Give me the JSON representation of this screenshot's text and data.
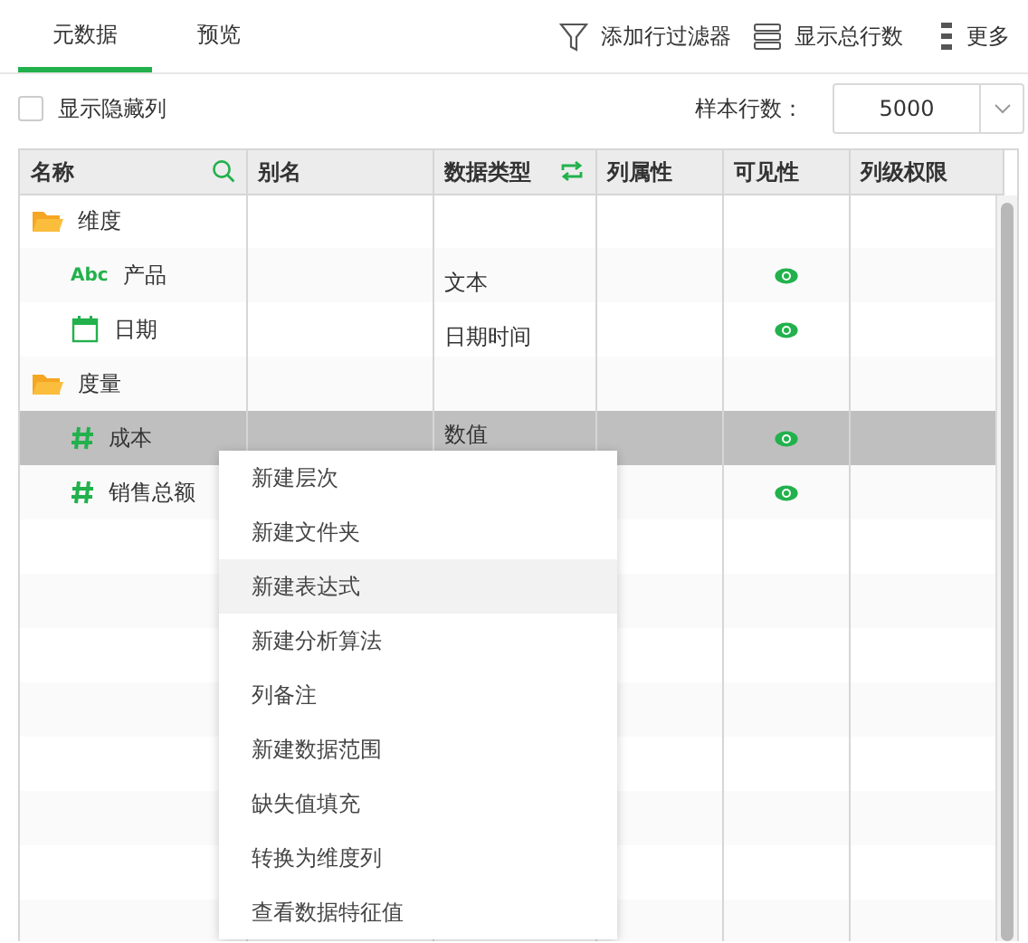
{
  "tabs": [
    {
      "label": "元数据",
      "selected": true
    },
    {
      "label": "预览",
      "selected": false
    }
  ],
  "toolbar": [
    {
      "kind": "filter",
      "label": "添加行过滤器"
    },
    {
      "kind": "rows",
      "label": "显示总行数"
    },
    {
      "kind": "more",
      "label": "更多"
    }
  ],
  "show_hidden": {
    "label": "显示隐藏列",
    "checked": false
  },
  "sample_rows": {
    "label": "样本行数：",
    "value": "5000"
  },
  "table": {
    "columns": [
      "名称",
      "别名",
      "数据类型",
      "列属性",
      "可见性",
      "列级权限"
    ],
    "rows": [
      {
        "kind": "folder",
        "name": "维度",
        "selected": false,
        "children": [
          {
            "kind": "text",
            "type_mark": "Abc",
            "name": "产品",
            "data_type": "文本",
            "visible": true,
            "selected": false
          },
          {
            "kind": "date",
            "name": "日期",
            "data_type": "日期时间",
            "visible": true,
            "selected": false
          }
        ]
      },
      {
        "kind": "folder",
        "name": "度量",
        "selected": false,
        "children": [
          {
            "kind": "number",
            "name": "成本",
            "data_type": "数值",
            "visible": true,
            "selected": true
          },
          {
            "kind": "number",
            "name": "销售总额",
            "visible": true,
            "selected": false
          }
        ]
      }
    ]
  },
  "context_menu": [
    {
      "label": "新建层次",
      "highlighted": false
    },
    {
      "label": "新建文件夹",
      "highlighted": false
    },
    {
      "label": "新建表达式",
      "highlighted": true
    },
    {
      "label": "新建分析算法",
      "highlighted": false
    },
    {
      "label": "列备注",
      "highlighted": false
    },
    {
      "label": "新建数据范围",
      "highlighted": false
    },
    {
      "label": "缺失值填充",
      "highlighted": false
    },
    {
      "label": "转换为维度列",
      "highlighted": false
    },
    {
      "label": "查看数据特征值",
      "highlighted": false
    }
  ]
}
